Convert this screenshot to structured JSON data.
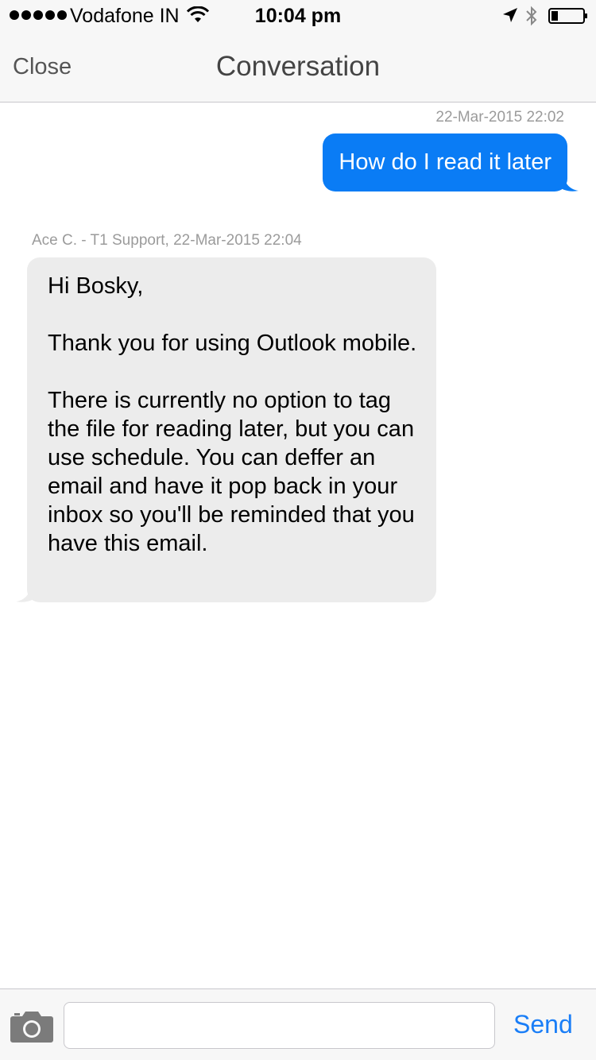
{
  "status_bar": {
    "carrier": "Vodafone IN",
    "time": "10:04 pm",
    "signal_bars": 5
  },
  "nav": {
    "close_label": "Close",
    "title": "Conversation"
  },
  "messages": {
    "sent": {
      "timestamp": "22-Mar-2015 22:02",
      "text": "How do I read it later"
    },
    "received": {
      "meta": "Ace C. - T1 Support, 22-Mar-2015 22:04",
      "paragraphs": [
        "Hi Bosky,",
        "Thank you for using Outlook mobile.",
        "There is currently no option to tag the file for reading later, but you can use schedule. You can deffer an email and have it pop back in your inbox so you'll be reminded that you have this email."
      ]
    }
  },
  "composer": {
    "input_value": "",
    "input_placeholder": "",
    "send_label": "Send"
  },
  "colors": {
    "accent": "#1a7ef7",
    "sent_bubble": "#0a7cf5",
    "received_bubble": "#ececec",
    "bar_background": "#f7f7f7"
  }
}
